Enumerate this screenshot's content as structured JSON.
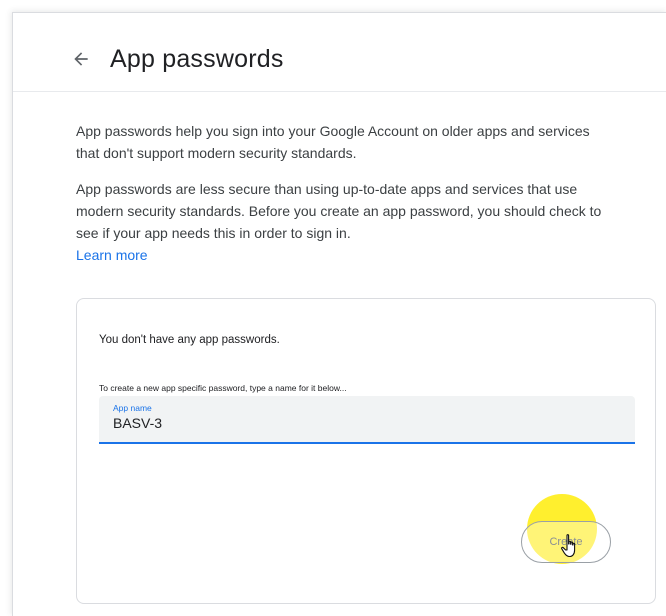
{
  "header": {
    "back_icon": "arrow-left-icon",
    "title": "App passwords"
  },
  "description": {
    "paragraph1": "App passwords help you sign into your Google Account on older apps and services that don't support modern security standards.",
    "paragraph2": "App passwords are less secure than using up-to-date apps and services that use modern security standards. Before you create an app password, you should check to see if your app needs this in order to sign in.",
    "learn_more": "Learn more"
  },
  "card": {
    "empty_message": "You don't have any app passwords.",
    "create_hint": "To create a new app specific password, type a name for it below...",
    "field": {
      "label": "App name",
      "value": "BASV-3"
    },
    "create_label": "Create",
    "cursor_icon": "hand-pointer-icon"
  },
  "colors": {
    "accent": "#1a73e8",
    "highlight": "#ffeb00",
    "field_background": "#f1f3f4"
  }
}
